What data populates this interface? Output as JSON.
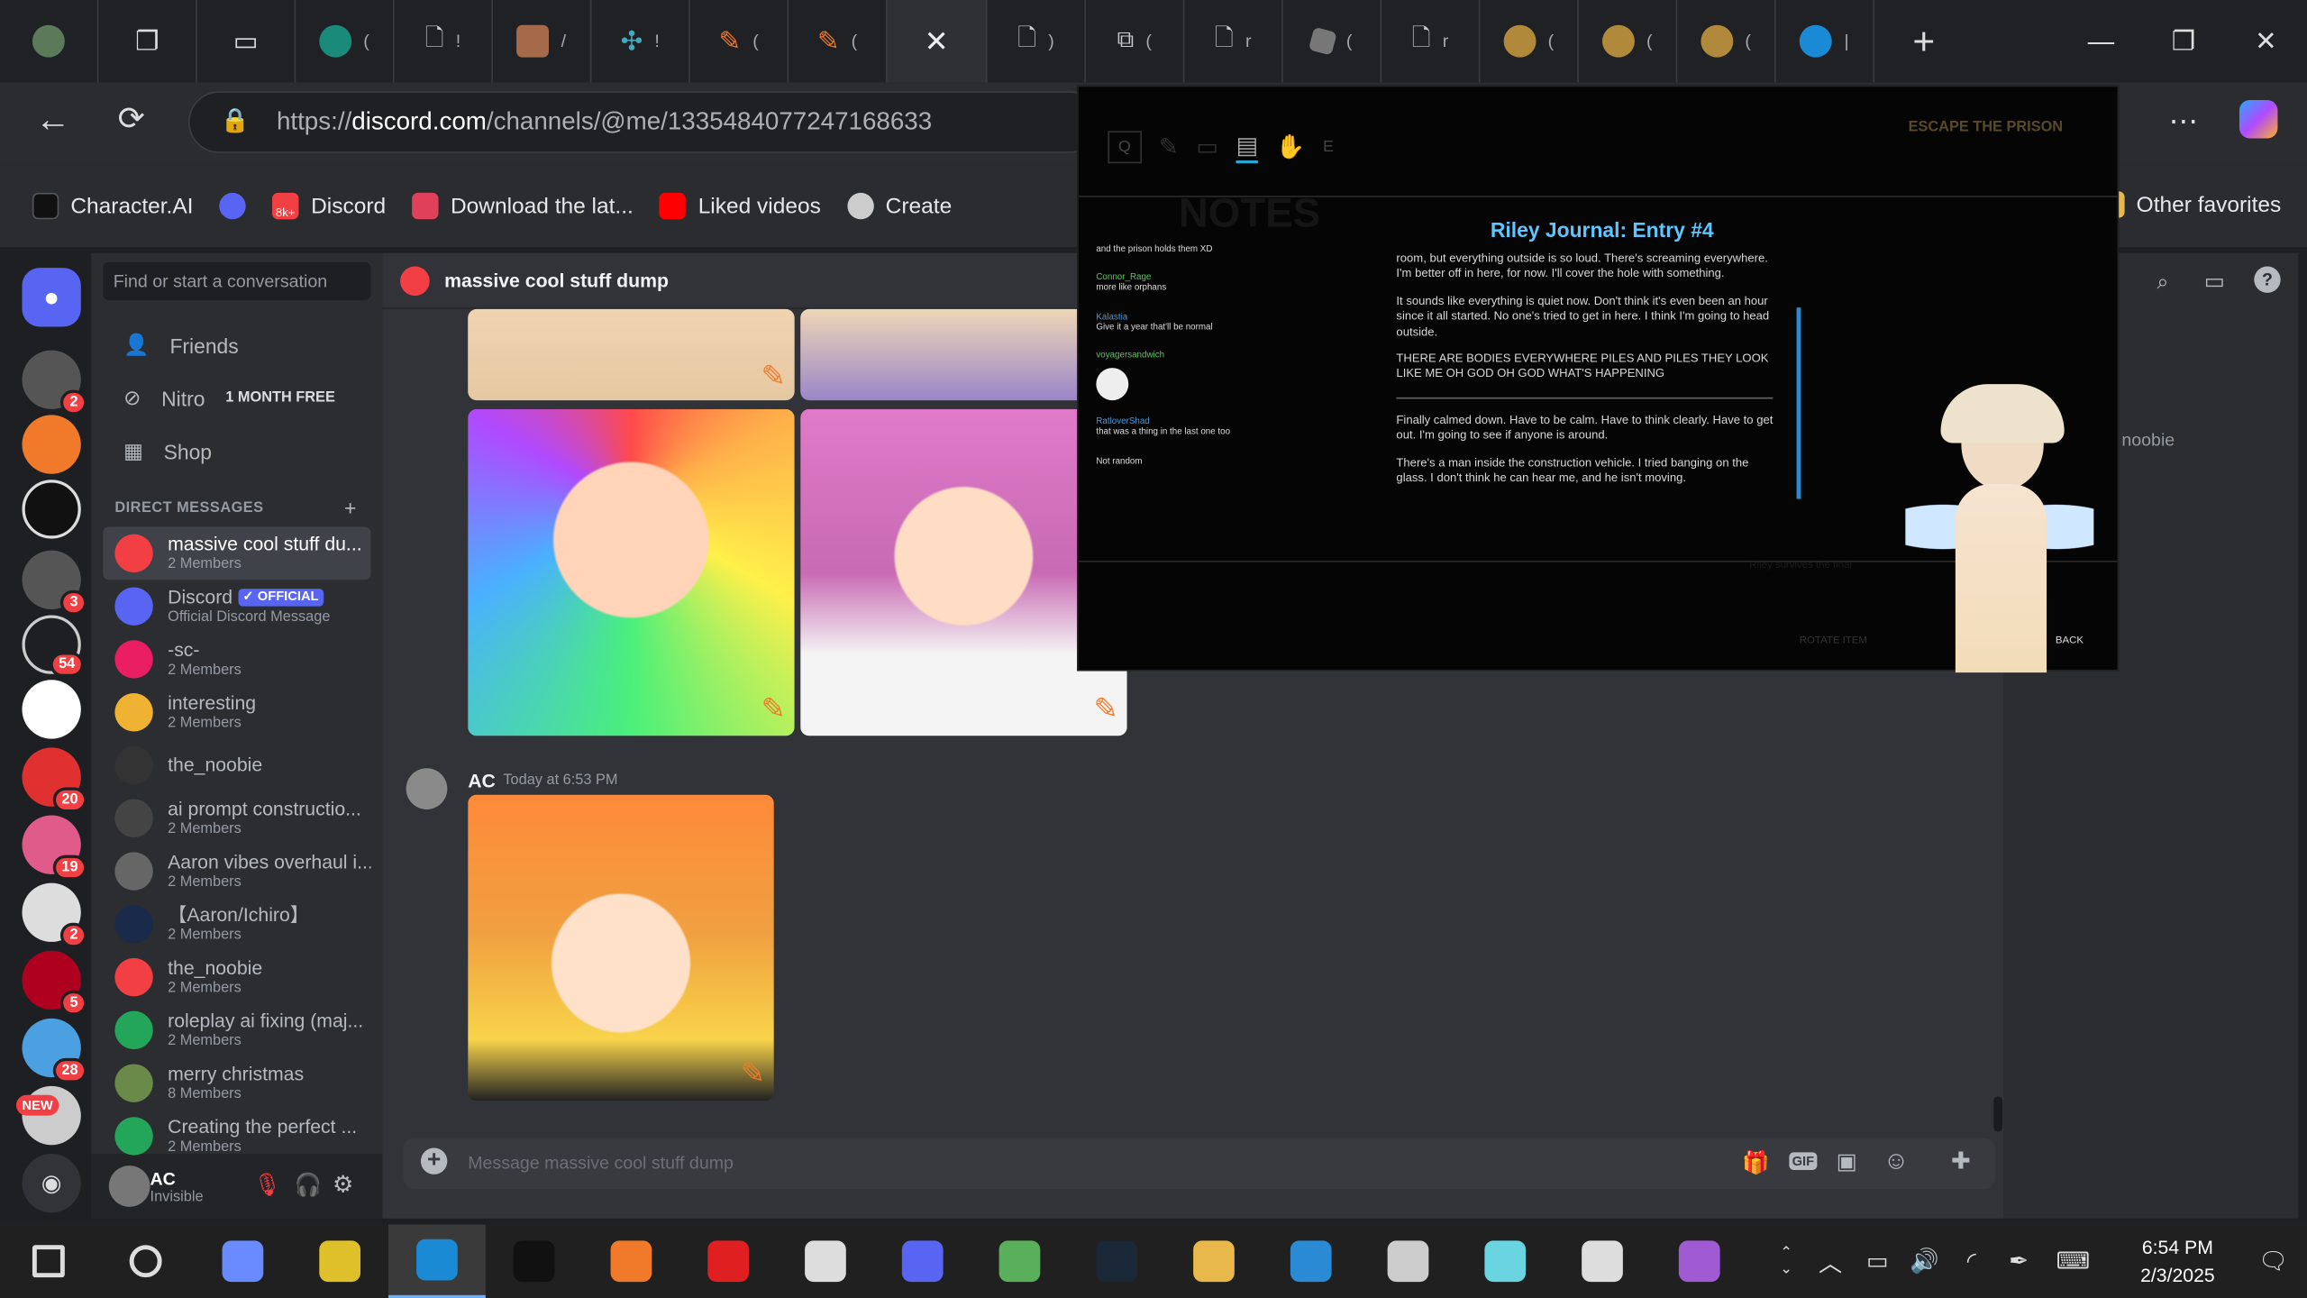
{
  "browser": {
    "url_prefix": "https://",
    "url_host": "discord.com",
    "url_path": "/channels/@me/1335484077247168633",
    "tabs": [
      {
        "icon": "profile-icon"
      },
      {
        "icon": "workspaces-icon"
      },
      {
        "icon": "tab-actions-icon"
      },
      {
        "icon": "site-icon"
      },
      {
        "icon": "page-icon"
      },
      {
        "icon": "anime-icon"
      },
      {
        "icon": "pinwheel-icon"
      },
      {
        "icon": "pencil-icon"
      },
      {
        "icon": "pencil-icon"
      },
      {
        "icon": "close-icon"
      },
      {
        "icon": "page-icon"
      },
      {
        "icon": "media-icon"
      },
      {
        "icon": "page-icon"
      },
      {
        "icon": "roblox-icon"
      },
      {
        "icon": "page-icon"
      },
      {
        "icon": "blob-icon"
      },
      {
        "icon": "blob-icon"
      },
      {
        "icon": "blob-icon"
      },
      {
        "icon": "edge-icon"
      }
    ],
    "new_tab": "+",
    "bookmarks": [
      {
        "label": "Character.AI",
        "icon": "cai-icon",
        "color": "#111111"
      },
      {
        "label": "",
        "icon": "discord-icon",
        "color": "#5865f2"
      },
      {
        "label": "Discord",
        "icon": "discord-icon",
        "color": "#f23f43",
        "badge": "8k+"
      },
      {
        "label": "Download the lat...",
        "icon": "download-icon",
        "color": "#e0405a"
      },
      {
        "label": "Liked videos",
        "icon": "youtube-icon",
        "color": "#ff0000"
      },
      {
        "label": "Create",
        "icon": "create-icon",
        "color": "#cccccc"
      }
    ],
    "other_favorites": "Other favorites"
  },
  "discord": {
    "search_placeholder": "Find or start a conversation",
    "nav": [
      {
        "label": "Friends",
        "icon": "friends-icon"
      },
      {
        "label": "Nitro",
        "icon": "nitro-icon",
        "badge": "1 MONTH FREE"
      },
      {
        "label": "Shop",
        "icon": "shop-icon"
      }
    ],
    "dm_header": "DIRECT MESSAGES",
    "dm_add": "+",
    "dms": [
      {
        "name": "massive cool stuff du...",
        "sub": "2 Members",
        "color": "#f23f43",
        "selected": true
      },
      {
        "name": "Discord",
        "sub": "Official Discord Message",
        "color": "#5865f2",
        "badge": "✓ OFFICIAL"
      },
      {
        "name": "-sc-",
        "sub": "2 Members",
        "color": "#e91e63"
      },
      {
        "name": "interesting",
        "sub": "2 Members",
        "color": "#f0b232"
      },
      {
        "name": "the_noobie",
        "sub": "",
        "color": "#333333"
      },
      {
        "name": "ai prompt constructio...",
        "sub": "2 Members",
        "color": "#444444"
      },
      {
        "name": "Aaron vibes overhaul i...",
        "sub": "2 Members",
        "color": "#666666"
      },
      {
        "name": "【Aaron/Ichiro】",
        "sub": "2 Members",
        "color": "#1a2a4a"
      },
      {
        "name": "the_noobie",
        "sub": "2 Members",
        "color": "#f23f43"
      },
      {
        "name": "roleplay ai fixing (maj...",
        "sub": "2 Members",
        "color": "#23a55a"
      },
      {
        "name": "merry christmas",
        "sub": "8 Members",
        "color": "#6a8a4a"
      },
      {
        "name": "Creating the perfect ...",
        "sub": "2 Members",
        "color": "#23a55a"
      }
    ],
    "guild_badges": [
      "2",
      "3",
      "54",
      "20",
      "19",
      "2",
      "5",
      "28"
    ],
    "new_badge": "NEW",
    "user": {
      "name": "AC",
      "status": "Invisible"
    },
    "channel": "massive cool stuff dump",
    "message": {
      "author": "AC",
      "time": "Today at 6:53 PM"
    },
    "composer_placeholder": "Message massive cool stuff dump",
    "gif_label": "GIF",
    "right_panel": {
      "member": "noobie"
    }
  },
  "game": {
    "mode": "ESCAPE THE PRISON",
    "notes_bg": "NOTES",
    "title": "Riley Journal: Entry #4",
    "paragraphs": [
      "room, but everything outside is so loud. There's screaming everywhere. I'm better off in here, for now. I'll cover the hole with something.",
      "It sounds like everything is quiet now. Don't think it's even been an hour since it all started. No one's tried to get in here. I think I'm going to head outside.",
      "THERE ARE BODIES EVERYWHERE PILES AND PILES THEY LOOK LIKE ME OH GOD OH GOD WHAT'S HAPPENING",
      "Finally calmed down. Have to be calm. Have to think clearly. Have to get out. I'm going to see if anyone is around.",
      "There's a man inside the construction vehicle. I tried banging on the glass. I don't think he can hear me, and he isn't moving."
    ],
    "chat": [
      {
        "user": "",
        "msg": "and the prison holds them XD"
      },
      {
        "user": "Connor_Rage",
        "msg": "more like orphans"
      },
      {
        "user": "Kalastia",
        "msg": "Give it a year that'll be normal"
      },
      {
        "user": "voyagersandwich",
        "msg": ""
      },
      {
        "user": "RatloverShad",
        "msg": "that was a thing in the last one too"
      },
      {
        "user": "",
        "msg": "Not random"
      }
    ],
    "rotate": "ROTATE ITEM",
    "back": "BACK",
    "faded1": "Riley survives the final"
  },
  "taskbar": {
    "time": "6:54 PM",
    "date": "2/3/2025",
    "apps": [
      {
        "icon": "start-icon"
      },
      {
        "icon": "search-icon"
      },
      {
        "icon": "copilot-icon"
      },
      {
        "icon": "app-icon"
      },
      {
        "icon": "edge-icon"
      },
      {
        "icon": "tiktok-icon"
      },
      {
        "icon": "app-icon"
      },
      {
        "icon": "opera-icon"
      },
      {
        "icon": "app-icon"
      },
      {
        "icon": "discord-icon"
      },
      {
        "icon": "app-icon"
      },
      {
        "icon": "steam-icon"
      },
      {
        "icon": "folder-icon"
      },
      {
        "icon": "store-icon"
      },
      {
        "icon": "roblox-icon"
      },
      {
        "icon": "app-icon"
      },
      {
        "icon": "settings-icon"
      },
      {
        "icon": "app-icon"
      }
    ]
  }
}
